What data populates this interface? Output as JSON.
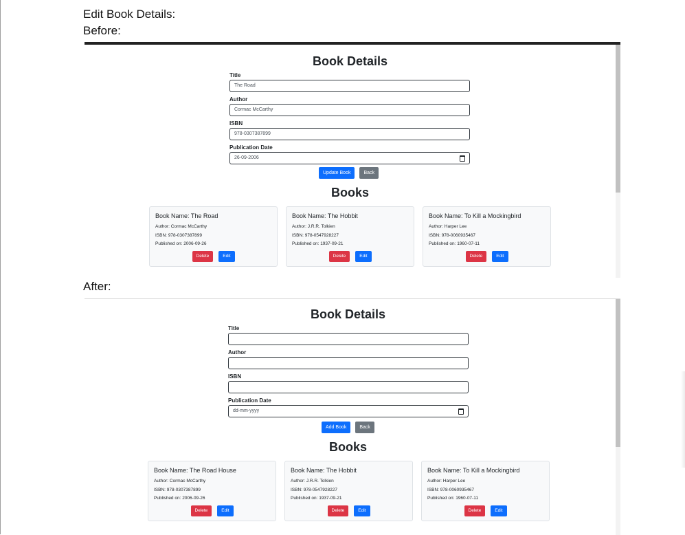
{
  "document": {
    "heading": "Edit Book Details:",
    "before_label": "Before:",
    "after_label": "After:"
  },
  "labels": {
    "title": "Title",
    "author": "Author",
    "isbn": "ISBN",
    "pub_date": "Publication Date",
    "back": "Back",
    "delete": "Delete",
    "edit": "Edit"
  },
  "before": {
    "form_title": "Book Details",
    "title_value": "The Road",
    "author_value": "Cormac McCarthy",
    "isbn_value": "978-0307387899",
    "date_value": "26-09-2006",
    "submit_label": "Update Book",
    "list_title": "Books",
    "books": [
      {
        "name": "Book Name: The Road",
        "author": "Author: Cormac McCarthy",
        "isbn": "ISBN: 978-0307387899",
        "published": "Published on: 2006-09-26"
      },
      {
        "name": "Book Name: The Hobbit",
        "author": "Author: J.R.R. Tolkien",
        "isbn": "ISBN: 978-0547928227",
        "published": "Published on: 1937-09-21"
      },
      {
        "name": "Book Name: To Kill a Mockingbird",
        "author": "Author: Harper Lee",
        "isbn": "ISBN: 978-0060935467",
        "published": "Published on: 1960-07-11"
      }
    ]
  },
  "after": {
    "form_title": "Book Details",
    "title_value": "",
    "author_value": "",
    "isbn_value": "",
    "date_value": "dd-mm-yyyy",
    "submit_label": "Add Book",
    "list_title": "Books",
    "books": [
      {
        "name": "Book Name: The Road House",
        "author": "Author: Cormac McCarthy",
        "isbn": "ISBN: 978-0307387899",
        "published": "Published on: 2006-09-26"
      },
      {
        "name": "Book Name: The Hobbit",
        "author": "Author: J.R.R. Tolkien",
        "isbn": "ISBN: 978-0547928227",
        "published": "Published on: 1937-09-21"
      },
      {
        "name": "Book Name: To Kill a Mockingbird",
        "author": "Author: Harper Lee",
        "isbn": "ISBN: 978-0060935467",
        "published": "Published on: 1960-07-11"
      }
    ]
  }
}
